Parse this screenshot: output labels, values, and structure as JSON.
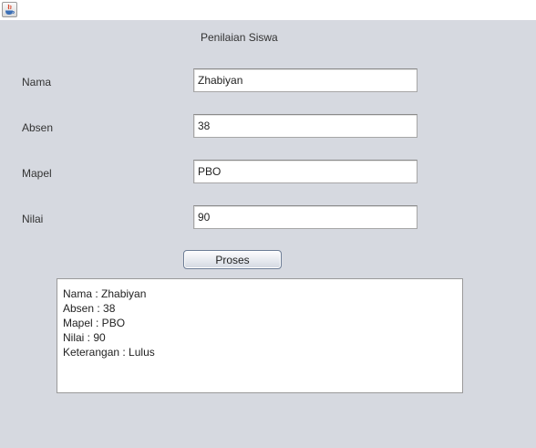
{
  "window": {
    "icon": "java-icon"
  },
  "form": {
    "title": "Penilaian Siswa",
    "fields": [
      {
        "label": "Nama",
        "value": "Zhabiyan"
      },
      {
        "label": "Absen",
        "value": "38"
      },
      {
        "label": "Mapel",
        "value": "PBO"
      },
      {
        "label": "Nilai",
        "value": "90"
      }
    ],
    "button_label": "Proses"
  },
  "output": {
    "lines": [
      "Nama : Zhabiyan",
      "Absen : 38",
      "Mapel : PBO",
      "Nilai : 90",
      "Keterangan : Lulus"
    ]
  }
}
